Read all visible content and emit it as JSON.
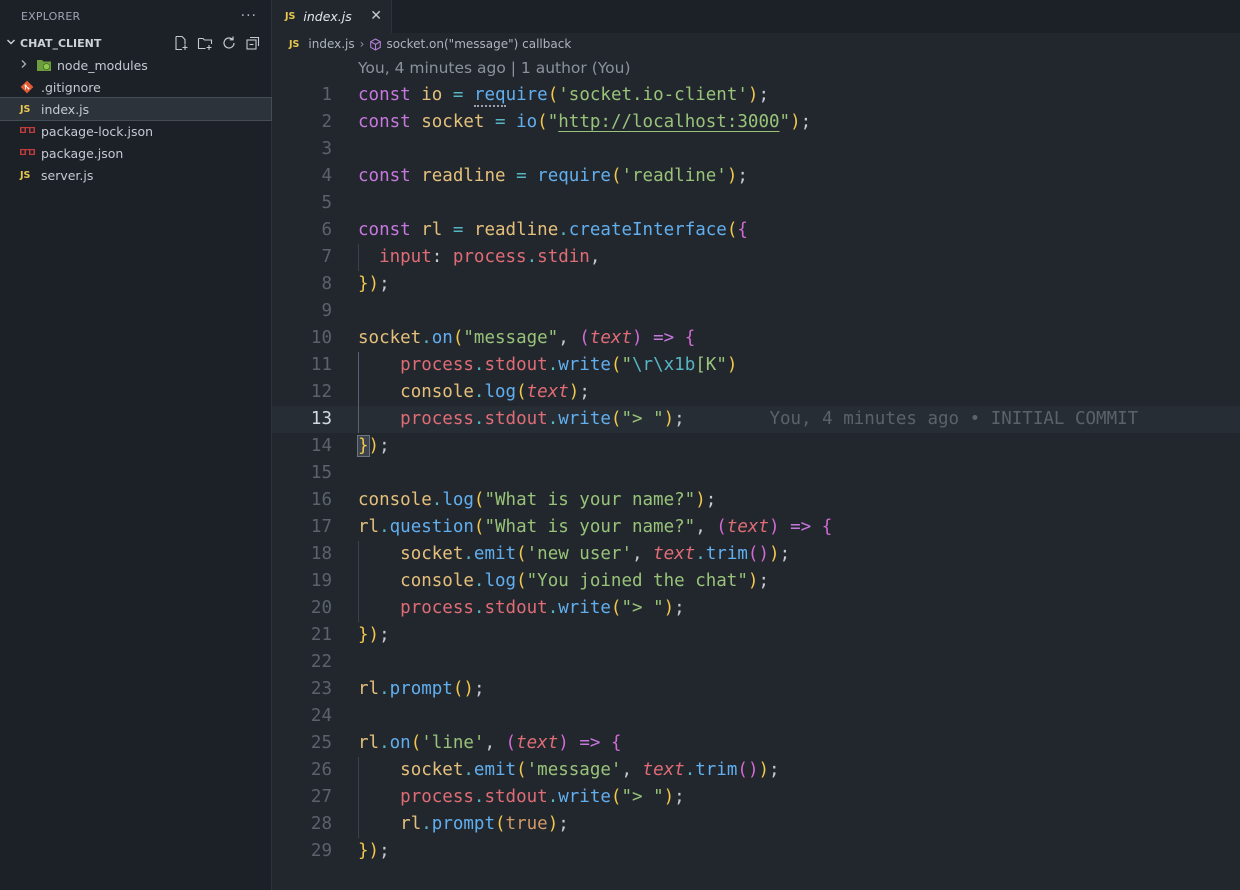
{
  "explorer": {
    "title": "EXPLORER",
    "more": "···",
    "section": "CHAT_CLIENT",
    "items": [
      {
        "label": "node_modules",
        "type": "folder",
        "icon": "node-folder-icon"
      },
      {
        "label": ".gitignore",
        "type": "file",
        "icon": "git-icon"
      },
      {
        "label": "index.js",
        "type": "file",
        "icon": "js-icon",
        "selected": true
      },
      {
        "label": "package-lock.json",
        "type": "file",
        "icon": "npm-icon"
      },
      {
        "label": "package.json",
        "type": "file",
        "icon": "npm-icon"
      },
      {
        "label": "server.js",
        "type": "file",
        "icon": "js-icon"
      }
    ]
  },
  "tab": {
    "badge": "JS",
    "label": "index.js",
    "close": "✕"
  },
  "breadcrumb": {
    "file": "index.js",
    "separator": "›",
    "symbol": "socket.on(\"message\") callback"
  },
  "editor": {
    "codelens": "You, 4 minutes ago | 1 author (You)",
    "blame": "You, 4 minutes ago • INITIAL COMMIT",
    "current_line": 13,
    "lines": [
      "const io = require('socket.io-client');",
      "const socket = io(\"http://localhost:3000\");",
      "",
      "const readline = require('readline');",
      "",
      "const rl = readline.createInterface({",
      "  input: process.stdin,",
      "});",
      "",
      "socket.on(\"message\", (text) => {",
      "    process.stdout.write(\"\\r\\x1b[K\")",
      "    console.log(text);",
      "    process.stdout.write(\"> \");",
      "});",
      "",
      "console.log(\"What is your name?\");",
      "rl.question(\"What is your name?\", (text) => {",
      "    socket.emit('new user', text.trim());",
      "    console.log(\"You joined the chat\");",
      "    process.stdout.write(\"> \");",
      "});",
      "",
      "rl.prompt();",
      "",
      "rl.on('line', (text) => {",
      "    socket.emit('message', text.trim());",
      "    process.stdout.write(\"> \");",
      "    rl.prompt(true);",
      "});"
    ]
  },
  "colors": {
    "editor_bg": "#22272e",
    "sidebar_bg": "#1c2128",
    "keyword": "#c678dd",
    "variable": "#e5c07b",
    "function": "#61afef",
    "string": "#98c379",
    "property": "#e06c75"
  }
}
